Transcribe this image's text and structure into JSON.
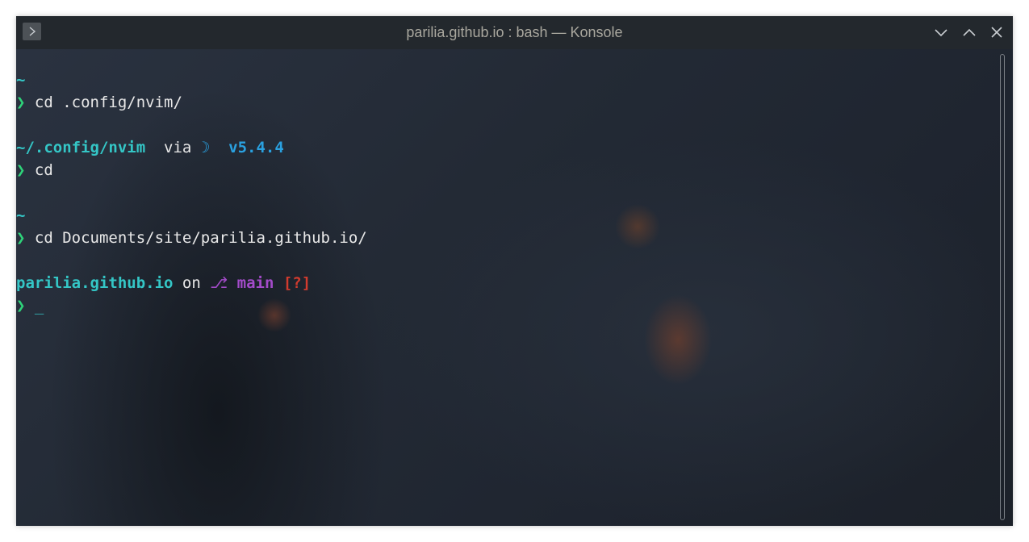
{
  "window": {
    "title": "parilia.github.io : bash — Konsole",
    "icon": "terminal-prompt-icon"
  },
  "controls": {
    "minimize": "chevron-down-icon",
    "maximize": "chevron-up-icon",
    "close": "close-icon"
  },
  "terminal": {
    "lines": [
      {
        "text": "~"
      },
      {
        "prompt": "❯",
        "command": "cd .config/nvim/"
      },
      {
        "path": "~/.config/nvim",
        "via": "via",
        "moon": "☽",
        "version": "v5.4.4"
      },
      {
        "prompt": "❯",
        "command": "cd"
      },
      {
        "text": "~"
      },
      {
        "prompt": "❯",
        "command": "cd Documents/site/parilia.github.io/"
      },
      {
        "path": "parilia.github.io",
        "on": "on",
        "branch_icon": "git-branch-icon",
        "branch_glyph": "⎇",
        "branch": "main",
        "status": "[?]"
      },
      {
        "prompt": "❯",
        "cursor": "_"
      }
    ]
  },
  "colors": {
    "path": "#34c6c6",
    "prompt": "#2ed37a",
    "version": "#2aa1e0",
    "branch": "#a34bc9",
    "status": "#d23b2e"
  }
}
